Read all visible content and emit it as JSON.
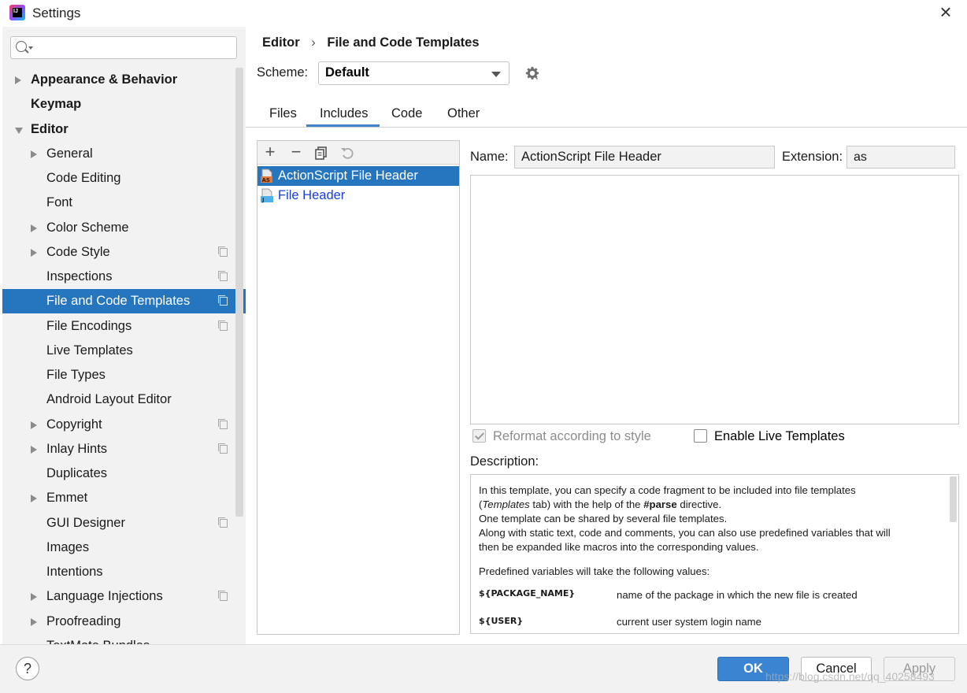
{
  "window": {
    "title": "Settings"
  },
  "search": {
    "placeholder": "",
    "value": ""
  },
  "sidebar": {
    "items": [
      {
        "label": "Appearance & Behavior",
        "bold": true,
        "arrow": "right",
        "indent": 0,
        "proj": false
      },
      {
        "label": "Keymap",
        "bold": true,
        "arrow": "none",
        "indent": 0,
        "proj": false
      },
      {
        "label": "Editor",
        "bold": true,
        "arrow": "down",
        "indent": 0,
        "proj": false
      },
      {
        "label": "General",
        "bold": false,
        "arrow": "right",
        "indent": 1,
        "proj": false
      },
      {
        "label": "Code Editing",
        "bold": false,
        "arrow": "none",
        "indent": 1,
        "proj": false
      },
      {
        "label": "Font",
        "bold": false,
        "arrow": "none",
        "indent": 1,
        "proj": false
      },
      {
        "label": "Color Scheme",
        "bold": false,
        "arrow": "right",
        "indent": 1,
        "proj": false
      },
      {
        "label": "Code Style",
        "bold": false,
        "arrow": "right",
        "indent": 1,
        "proj": true
      },
      {
        "label": "Inspections",
        "bold": false,
        "arrow": "none",
        "indent": 1,
        "proj": true
      },
      {
        "label": "File and Code Templates",
        "bold": false,
        "arrow": "none",
        "indent": 1,
        "proj": true,
        "selected": true
      },
      {
        "label": "File Encodings",
        "bold": false,
        "arrow": "none",
        "indent": 1,
        "proj": true
      },
      {
        "label": "Live Templates",
        "bold": false,
        "arrow": "none",
        "indent": 1,
        "proj": false
      },
      {
        "label": "File Types",
        "bold": false,
        "arrow": "none",
        "indent": 1,
        "proj": false
      },
      {
        "label": "Android Layout Editor",
        "bold": false,
        "arrow": "none",
        "indent": 1,
        "proj": false
      },
      {
        "label": "Copyright",
        "bold": false,
        "arrow": "right",
        "indent": 1,
        "proj": true
      },
      {
        "label": "Inlay Hints",
        "bold": false,
        "arrow": "right",
        "indent": 1,
        "proj": true
      },
      {
        "label": "Duplicates",
        "bold": false,
        "arrow": "none",
        "indent": 1,
        "proj": false
      },
      {
        "label": "Emmet",
        "bold": false,
        "arrow": "right",
        "indent": 1,
        "proj": false
      },
      {
        "label": "GUI Designer",
        "bold": false,
        "arrow": "none",
        "indent": 1,
        "proj": true
      },
      {
        "label": "Images",
        "bold": false,
        "arrow": "none",
        "indent": 1,
        "proj": false
      },
      {
        "label": "Intentions",
        "bold": false,
        "arrow": "none",
        "indent": 1,
        "proj": false
      },
      {
        "label": "Language Injections",
        "bold": false,
        "arrow": "right",
        "indent": 1,
        "proj": true
      },
      {
        "label": "Proofreading",
        "bold": false,
        "arrow": "right",
        "indent": 1,
        "proj": false
      },
      {
        "label": "TextMate Bundles",
        "bold": false,
        "arrow": "none",
        "indent": 1,
        "proj": false
      }
    ]
  },
  "breadcrumb": {
    "parent": "Editor",
    "separator": "›",
    "current": "File and Code Templates"
  },
  "scheme": {
    "label": "Scheme:",
    "value": "Default"
  },
  "tabs": [
    {
      "label": "Files",
      "active": false
    },
    {
      "label": "Includes",
      "active": true
    },
    {
      "label": "Code",
      "active": false
    },
    {
      "label": "Other",
      "active": false
    }
  ],
  "toolbar": {
    "add": "+",
    "remove": "−"
  },
  "templates": [
    {
      "label": "ActionScript File Header",
      "icon_text": "AS",
      "selected": true
    },
    {
      "label": "File Header",
      "icon_text": "J",
      "selected": false
    }
  ],
  "editor": {
    "name_label": "Name:",
    "name_value": "ActionScript File Header",
    "extension_label": "Extension:",
    "extension_value": "as",
    "content": ""
  },
  "options": {
    "reformat_label": "Reformat according to style",
    "reformat_checked": true,
    "reformat_enabled": false,
    "live_templates_label": "Enable Live Templates",
    "live_templates_checked": false
  },
  "description": {
    "label": "Description:",
    "line1": "In this template, you can specify a code fragment to be included into file templates",
    "line2_pre": "(",
    "line2_italic": "Templates",
    "line2_mid": " tab) with the help of the ",
    "line2_bold": "#parse",
    "line2_post": " directive.",
    "line3": "One template can be shared by several file templates.",
    "line4": "Along with static text, code and comments, you can also use predefined variables that will",
    "line5": "then be expanded like macros into the corresponding values.",
    "predefined": "Predefined variables will take the following values:",
    "variables": [
      {
        "name": "${PACKAGE_NAME}",
        "desc": "name of the package in which the new file is created"
      },
      {
        "name": "${USER}",
        "desc": "current user system login name"
      }
    ]
  },
  "buttons": {
    "help": "?",
    "ok": "OK",
    "cancel": "Cancel",
    "apply": "Apply"
  },
  "watermark": "https://blog.csdn.net/qq_40258493",
  "colors": {
    "selection": "#2675bf",
    "accent": "#4083c9",
    "ok_button": "#3b84d2",
    "link": "#1a3fd6"
  }
}
